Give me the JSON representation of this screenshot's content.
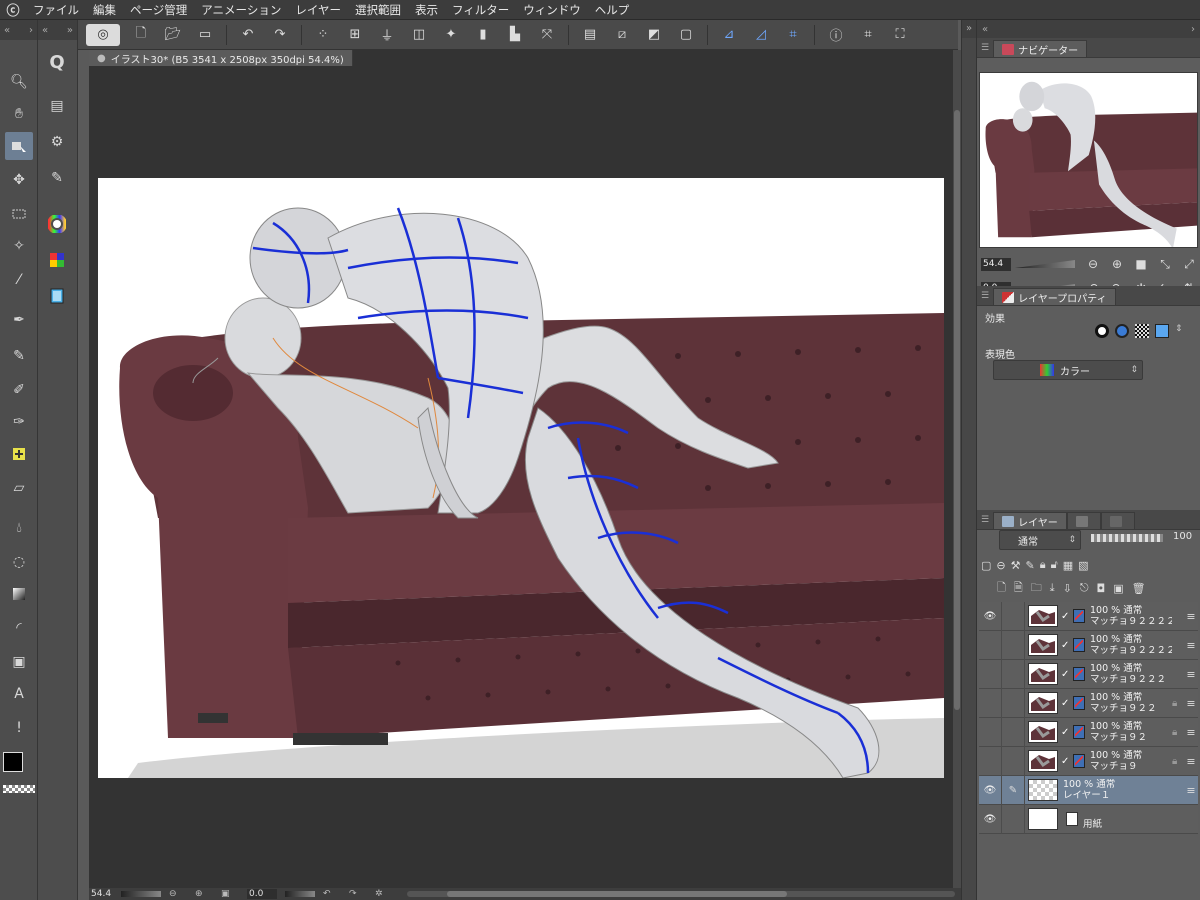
{
  "menu": [
    "ファイル",
    "編集",
    "ページ管理",
    "アニメーション",
    "レイヤー",
    "選択範囲",
    "表示",
    "フィルター",
    "ウィンドウ",
    "ヘルプ"
  ],
  "document": {
    "tab_title": "イラスト30* (B5 3541 x 2508px 350dpi 54.4%)"
  },
  "status": {
    "zoom": "54.4",
    "angle": "0.0"
  },
  "navigator": {
    "tab_label": "ナビゲーター",
    "zoom": "54.4",
    "angle": "0.0"
  },
  "layer_property": {
    "tab_label": "レイヤープロパティ",
    "effect_label": "効果",
    "expression_color_label": "表現色",
    "expression_color_value": "カラー"
  },
  "layers_panel": {
    "tab_label": "レイヤー",
    "blend_mode": "通常",
    "opacity": "100"
  },
  "layers": [
    {
      "line1": "100 % 通常",
      "line2": "マッチョ９２２２２２",
      "visible": true,
      "locked": false,
      "type": "3d"
    },
    {
      "line1": "100 % 通常",
      "line2": "マッチョ９２２２２",
      "visible": false,
      "locked": false,
      "type": "3d"
    },
    {
      "line1": "100 % 通常",
      "line2": "マッチョ９２２２",
      "visible": false,
      "locked": false,
      "type": "3d"
    },
    {
      "line1": "100 % 通常",
      "line2": "マッチョ９２２",
      "visible": false,
      "locked": true,
      "type": "3d"
    },
    {
      "line1": "100 % 通常",
      "line2": "マッチョ９２",
      "visible": false,
      "locked": true,
      "type": "3d"
    },
    {
      "line1": "100 % 通常",
      "line2": "マッチョ９",
      "visible": false,
      "locked": true,
      "type": "3d"
    },
    {
      "line1": "100 % 通常",
      "line2": "レイヤー１",
      "visible": true,
      "locked": false,
      "type": "raster",
      "selected": true
    },
    {
      "line1": "",
      "line2": "用紙",
      "visible": true,
      "locked": false,
      "type": "paper"
    }
  ],
  "colors": {
    "sofa": "#5b3238",
    "selection": "#6f8196",
    "mannequin": "#dcdde0",
    "guide_lines": "#1a2fd6"
  }
}
